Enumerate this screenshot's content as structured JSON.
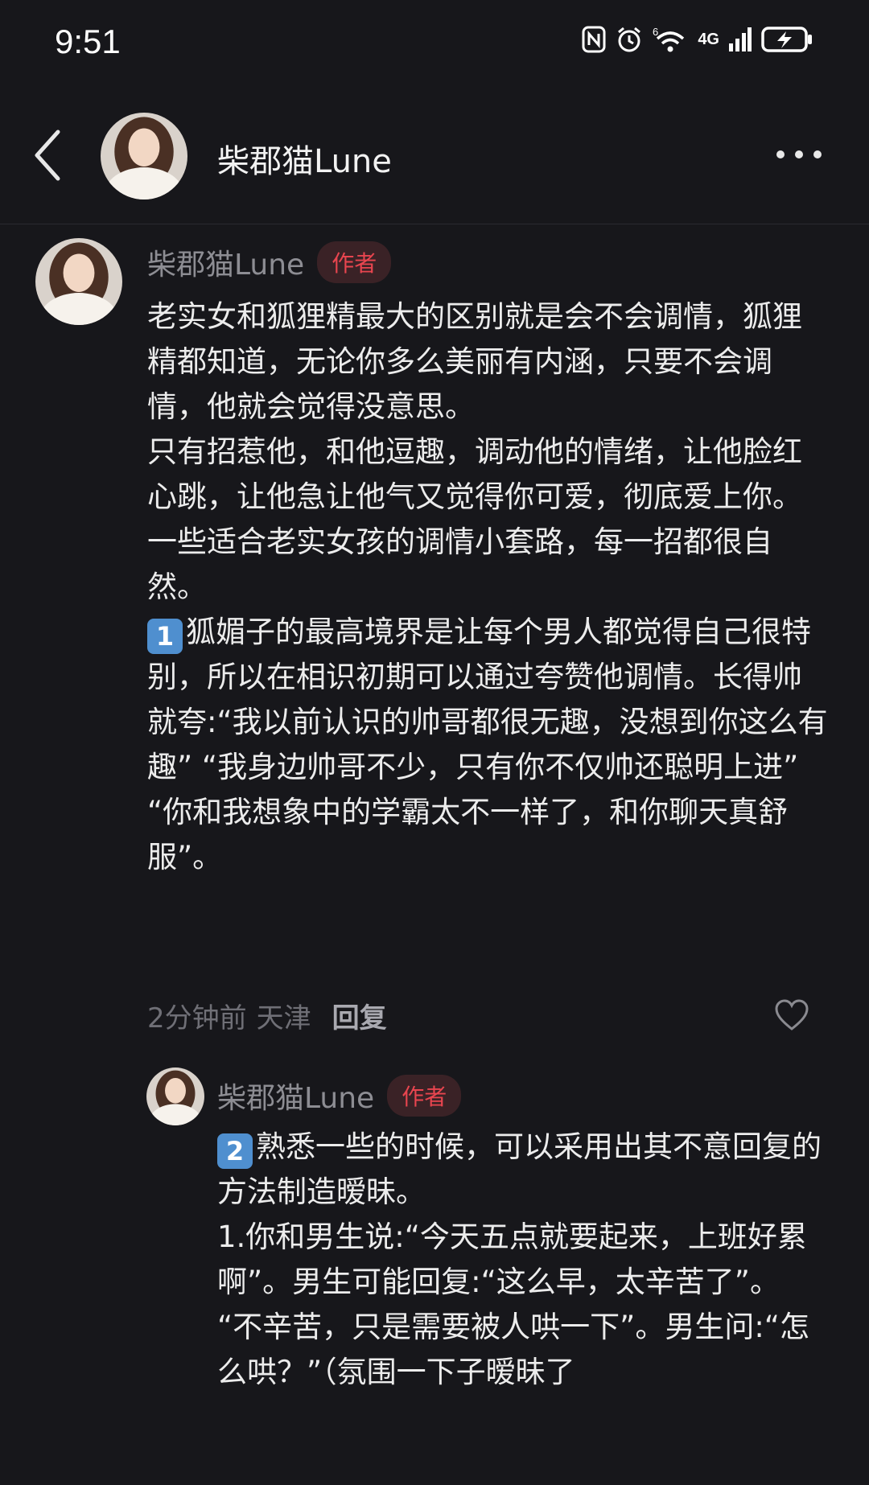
{
  "status_bar": {
    "time": "9:51",
    "icons": [
      "nfc-icon",
      "alarm-icon",
      "wifi-icon",
      "signal-icon",
      "battery-charging-icon"
    ],
    "network_label": "4G",
    "wifi_label": "6"
  },
  "header": {
    "title": "柴郡猫Lune",
    "back_icon": "back-icon",
    "more_icon": "more-icon"
  },
  "comments": [
    {
      "author": "柴郡猫Lune",
      "badge": "作者",
      "paragraphs": [
        "老实女和狐狸精最大的区别就是会不会调情，狐狸精都知道，无论你多么美丽有内涵，只要不会调情，他就会觉得没意思。",
        "只有招惹他，和他逗趣，调动他的情绪，让他脸红心跳，让他急让他气又觉得你可爱，彻底爱上你。一些适合老实女孩的调情小套路，每一招都很自然。",
        "狐媚子的最高境界是让每个男人都觉得自己很特别，所以在相识初期可以通过夸赞他调情。长得帅就夸:“我以前认识的帅哥都很无趣，没想到你这么有趣” “我身边帅哥不少，只有你不仅帅还聪明上进” “你和我想象中的学霸太不一样了，和你聊天真舒服”。"
      ],
      "number_badge": "1",
      "time": "2分钟前",
      "location": "天津",
      "reply_label": "回复"
    },
    {
      "author": "柴郡猫Lune",
      "badge": "作者",
      "number_badge": "2",
      "paragraphs": [
        "熟悉一些的时候，可以采用出其不意回复的方法制造暧昧。",
        "1.你和男生说:“今天五点就要起来，上班好累啊”。男生可能回复:“这么早，太辛苦了”。",
        "“不辛苦，只是需要被人哄一下”。男生问:“怎么哄？”（氛围一下子暧昧了"
      ]
    }
  ],
  "colors": {
    "background": "#17171b",
    "badge_text": "#e8454f",
    "badge_bg": "#3a2226",
    "number_badge": "#4f8fcf"
  }
}
